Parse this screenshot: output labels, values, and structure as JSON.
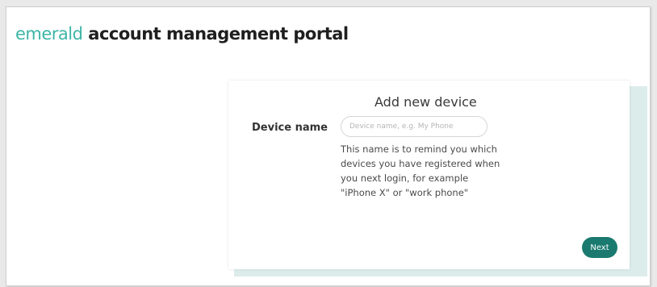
{
  "header": {
    "brand_emerald": "emerald",
    "brand_rest": "account management portal"
  },
  "card": {
    "title": "Add new device",
    "device_name_label": "Device name",
    "device_name_placeholder": "Device name, e.g. My Phone",
    "device_name_value": "",
    "help_text": "This name is to remind you which devices you have registered when you next login, for example \"iPhone X\" or \"work phone\"",
    "next_label": "Next"
  },
  "colors": {
    "brand_accent": "#3cb5a6",
    "button_bg": "#1a7a70",
    "card_shadow": "#dceceb"
  }
}
